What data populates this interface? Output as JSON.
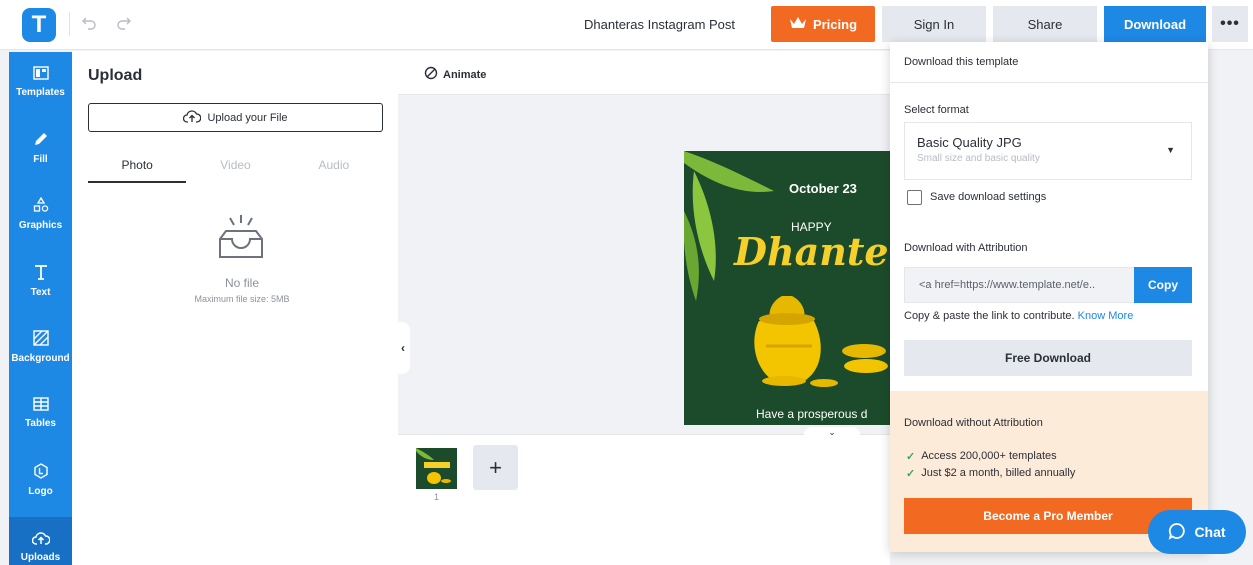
{
  "header": {
    "logo_letter": "T",
    "doc_title": "Dhanteras Instagram Post",
    "pricing_label": "Pricing",
    "signin_label": "Sign In",
    "share_label": "Share",
    "download_label": "Download",
    "more_label": "•••"
  },
  "sidebar": {
    "items": [
      {
        "label": "Templates",
        "icon": "templates-icon"
      },
      {
        "label": "Fill",
        "icon": "pencil-icon"
      },
      {
        "label": "Graphics",
        "icon": "shapes-icon"
      },
      {
        "label": "Text",
        "icon": "text-icon"
      },
      {
        "label": "Background",
        "icon": "background-icon"
      },
      {
        "label": "Tables",
        "icon": "table-icon"
      },
      {
        "label": "Logo",
        "icon": "logo-icon"
      },
      {
        "label": "Uploads",
        "icon": "cloud-upload-icon"
      }
    ]
  },
  "upload_panel": {
    "title": "Upload",
    "upload_button": "Upload your File",
    "tabs": [
      "Photo",
      "Video",
      "Audio"
    ],
    "empty_title": "No file",
    "empty_note": "Maximum file size: 5MB"
  },
  "toolbar": {
    "animate_label": "Animate"
  },
  "design": {
    "date": "October 23",
    "happy": "HAPPY",
    "headline": "Dhanter",
    "greeting": "Have a prosperous d"
  },
  "pages": {
    "thumb_number": "1",
    "add_label": "+"
  },
  "download_menu": {
    "heading": "Download this template",
    "select_format_label": "Select format",
    "format_name": "Basic Quality JPG",
    "format_desc": "Small size and basic quality",
    "save_settings_label": "Save download settings",
    "attribution_label": "Download with Attribution",
    "attribution_code": "<a href=https://www.template.net/e..",
    "copy_label": "Copy",
    "paste_note": "Copy & paste the link to contribute.",
    "know_more": "Know More",
    "free_download_label": "Free Download",
    "pro_title": "Download without Attribution",
    "perks": [
      "Access 200,000+ templates",
      "Just $2 a month, billed annually"
    ],
    "pro_button": "Become a Pro Member"
  },
  "chat": {
    "label": "Chat"
  },
  "colors": {
    "brand_blue": "#1e88e5",
    "accent_orange": "#f26a21",
    "design_green": "#1b4b2a",
    "design_gold": "#f6d02a",
    "pro_bg": "#fdebd9"
  }
}
